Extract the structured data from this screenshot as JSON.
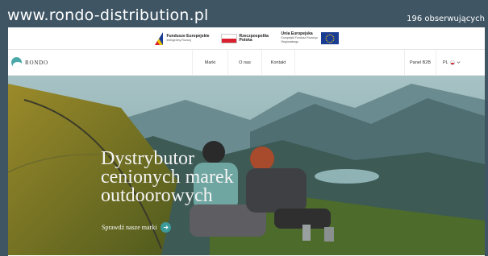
{
  "overlay": {
    "site_url": "www.rondo-distribution.pl",
    "followers": "196 obserwujących"
  },
  "eu_strip": {
    "funds_title": "Fundusze Europejskie",
    "funds_sub": "Inteligentny Rozwój",
    "poland_title": "Rzeczpospolita Polska",
    "eu_title": "Unia Europejska",
    "eu_sub": "Europejski Fundusz Rozwoju Regionalnego"
  },
  "nav": {
    "brand": "RONDO",
    "items": [
      {
        "label": "Marki"
      },
      {
        "label": "O nas"
      },
      {
        "label": "Kontakt"
      }
    ],
    "b2b": "Panel B2B",
    "lang": "PL"
  },
  "hero": {
    "title_lines": [
      "Dystrybutor",
      "cenionych marek",
      "outdoorowych"
    ],
    "cta_label": "Sprawdź nasze marki"
  },
  "colors": {
    "accent": "#3c9a9a",
    "overlay_bg": "#3f5564",
    "poland_red": "#d8202f",
    "eu_blue": "#1a3d94"
  },
  "icons": {
    "brand_logo": "rondo-logo-icon",
    "cta_arrow": "arrow-right-icon",
    "lang_chevron": "chevron-down-icon"
  }
}
